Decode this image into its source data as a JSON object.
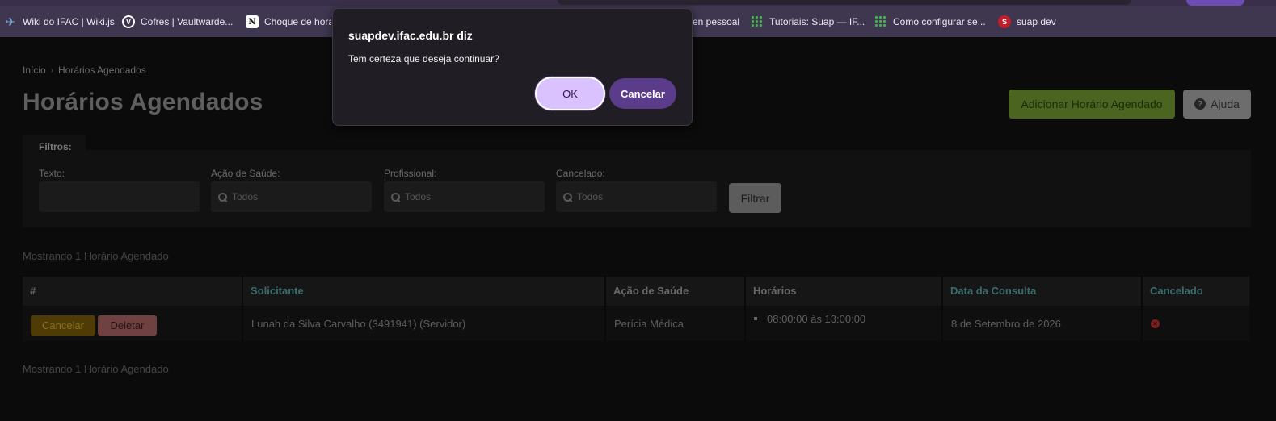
{
  "browser": {
    "bookmarks": [
      {
        "label": "Wiki do IFAC | Wiki.js",
        "icon": "wiki-bird-icon"
      },
      {
        "label": "Cofres | Vaultwarde...",
        "icon": "vaultwarden-icon"
      },
      {
        "label": "Choque de horá",
        "icon": "notion-icon"
      },
      {
        "label": "en pessoal",
        "icon": "none"
      },
      {
        "label": "Tutoriais: Suap — IF...",
        "icon": "ifac-grid-icon"
      },
      {
        "label": "Como configurar se...",
        "icon": "ifac-grid-icon"
      },
      {
        "label": "suap dev",
        "icon": "suap-icon"
      }
    ]
  },
  "breadcrumb": {
    "home": "Início",
    "separator": "›",
    "current": "Horários Agendados"
  },
  "page": {
    "title": "Horários Agendados",
    "add_button": "Adicionar Horário Agendado",
    "help_button": "Ajuda"
  },
  "filters": {
    "tab_label": "Filtros:",
    "texto": {
      "label": "Texto:",
      "value": ""
    },
    "acao_saude": {
      "label": "Ação de Saúde:",
      "placeholder": "Todos"
    },
    "profissional": {
      "label": "Profissional:",
      "placeholder": "Todos"
    },
    "cancelado": {
      "label": "Cancelado:",
      "placeholder": "Todos"
    },
    "submit": "Filtrar"
  },
  "results": {
    "summary_top": "Mostrando 1 Horário Agendado",
    "summary_bottom": "Mostrando 1 Horário Agendado"
  },
  "table": {
    "columns": [
      "#",
      "Solicitante",
      "Ação de Saúde",
      "Horários",
      "Data da Consulta",
      "Cancelado"
    ],
    "rows": [
      {
        "actions": {
          "cancel": "Cancelar",
          "delete": "Deletar"
        },
        "solicitante": "Lunah da Silva Carvalho (3491941) (Servidor)",
        "acao_saude": "Perícia Médica",
        "horarios": [
          "08:00:00 às 13:00:00"
        ],
        "data_consulta": "8 de Setembro de 2026",
        "cancelado": false
      }
    ]
  },
  "dialog": {
    "title": "suapdev.ifac.edu.br diz",
    "message": "Tem certeza que deseja continuar?",
    "ok": "OK",
    "cancel": "Cancelar"
  },
  "colors": {
    "accent": "#d9c2ff",
    "dialog_cancel": "#5a3c8a",
    "add_button": "#4b6520",
    "sortable_header": "#3c6b6b"
  }
}
